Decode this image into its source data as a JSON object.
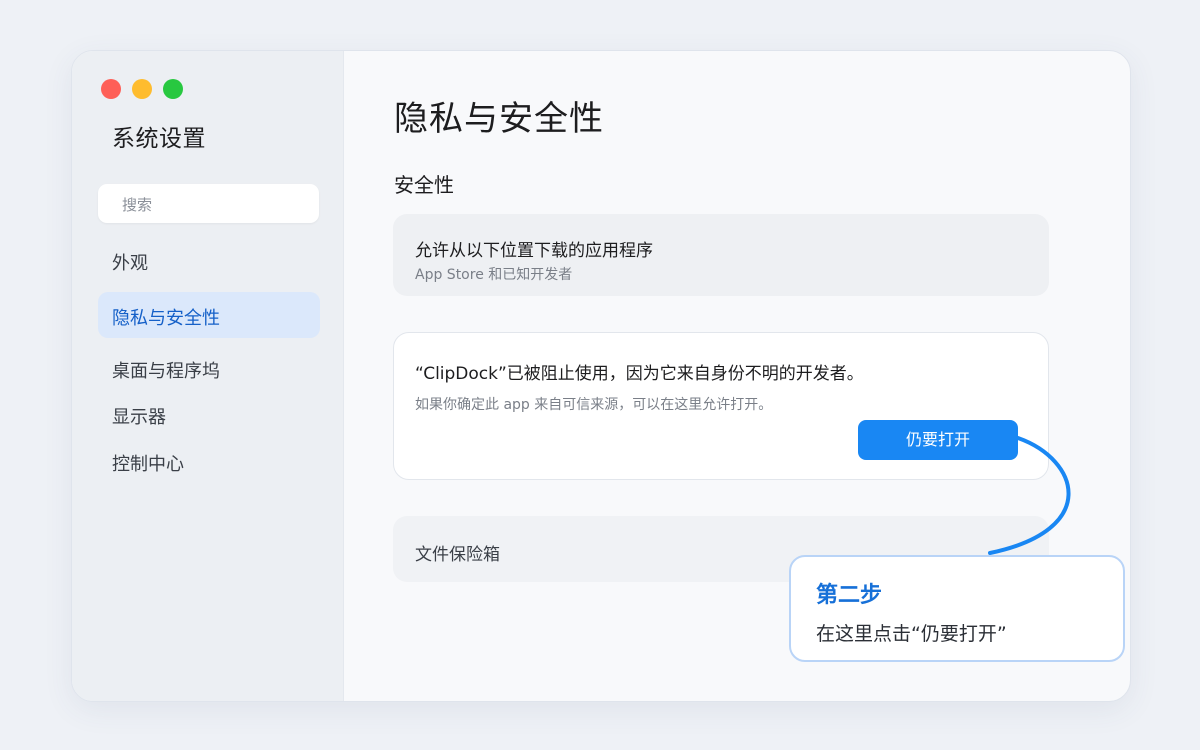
{
  "window": {
    "title": "系统设置",
    "controls": [
      "close",
      "minimize",
      "zoom"
    ]
  },
  "sidebar": {
    "search_placeholder": "搜索",
    "items": [
      {
        "label": "外观",
        "active": false
      },
      {
        "label": "隐私与安全性",
        "active": true
      },
      {
        "label": "桌面与程序坞",
        "active": false
      },
      {
        "label": "显示器",
        "active": false
      },
      {
        "label": "控制中心",
        "active": false
      }
    ]
  },
  "main": {
    "title": "隐私与安全性",
    "section_title": "安全性",
    "allow_card": {
      "title": "允许从以下位置下载的应用程序",
      "subtitle": "App Store 和已知开发者"
    },
    "blocked_card": {
      "message": "“ClipDock”已被阻止使用，因为它来自身份不明的开发者。",
      "hint": "如果你确定此 app 来自可信来源，可以在这里允许打开。",
      "button_label": "仍要打开"
    },
    "vault_card": {
      "title": "文件保险箱"
    }
  },
  "callout": {
    "step": "第二步",
    "text": "在这里点击“仍要打开”"
  },
  "colors": {
    "accent": "#1987f3",
    "active_nav_bg": "#dbe8fb",
    "callout_border": "#b9d4f7",
    "connector": "#1987f3"
  }
}
